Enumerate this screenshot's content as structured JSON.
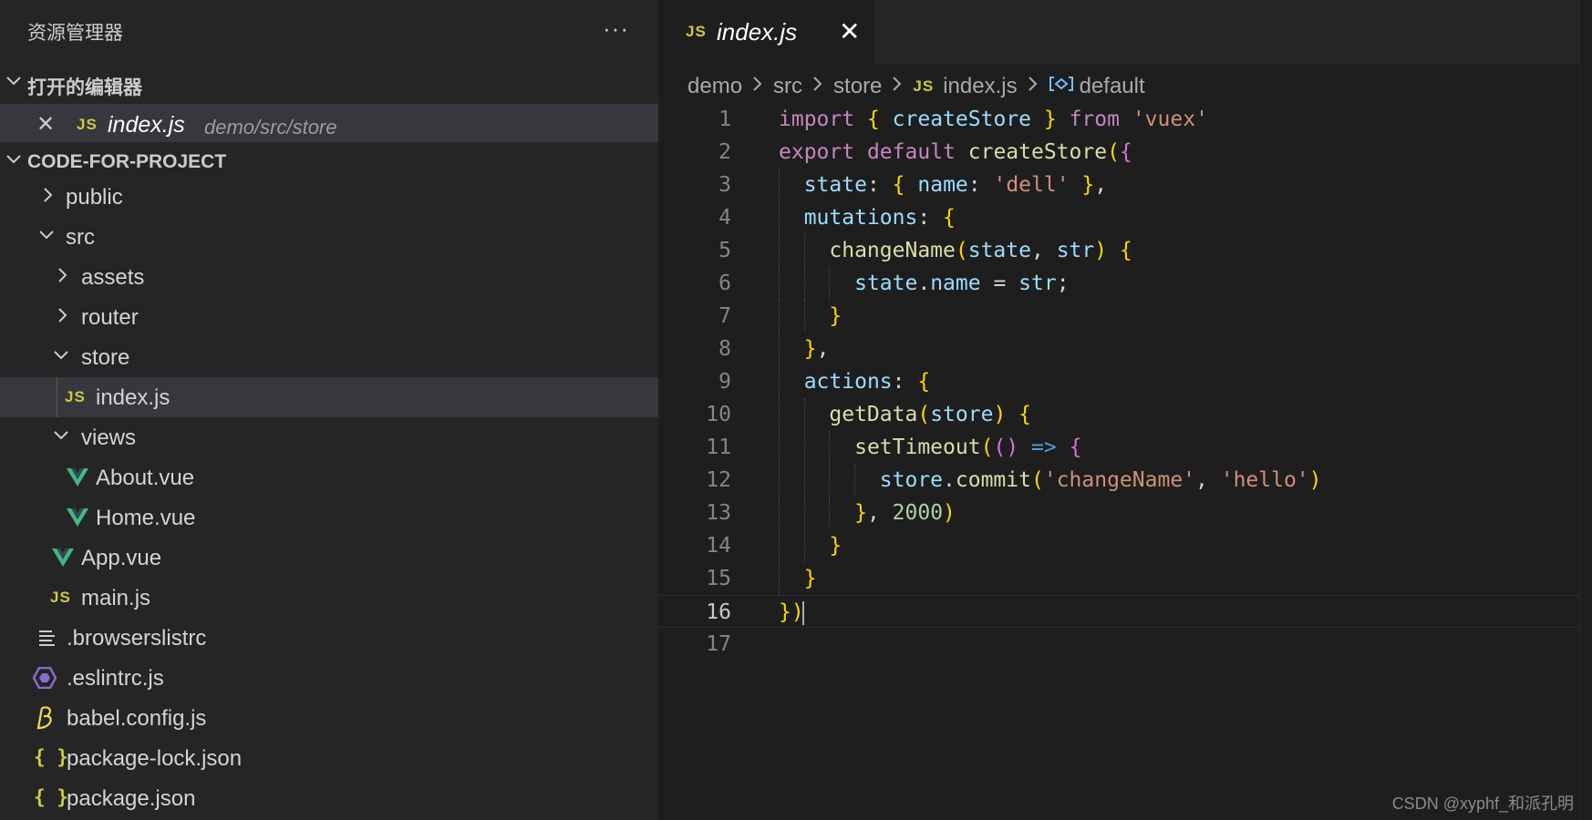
{
  "sidebar": {
    "title": "资源管理器",
    "more_label": "···",
    "open_editors": {
      "header": "打开的编辑器",
      "items": [
        {
          "close": "✕",
          "badge": "JS",
          "name": "index.js",
          "path": "demo/src/store"
        }
      ]
    },
    "project": {
      "header": "CODE-FOR-PROJECT",
      "tree": [
        {
          "label": "public",
          "icon": "chevron-right"
        },
        {
          "label": "src",
          "icon": "chevron-down"
        },
        {
          "label": "assets",
          "icon": "chevron-right"
        },
        {
          "label": "router",
          "icon": "chevron-right"
        },
        {
          "label": "store",
          "icon": "chevron-down"
        },
        {
          "label": "index.js",
          "icon": "js",
          "badge": "JS",
          "selected": true
        },
        {
          "label": "views",
          "icon": "chevron-down"
        },
        {
          "label": "About.vue",
          "icon": "vue"
        },
        {
          "label": "Home.vue",
          "icon": "vue"
        },
        {
          "label": "App.vue",
          "icon": "vue"
        },
        {
          "label": "main.js",
          "icon": "js",
          "badge": "JS"
        },
        {
          "label": ".browserslistrc",
          "icon": "lines"
        },
        {
          "label": ".eslintrc.js",
          "icon": "eslint"
        },
        {
          "label": "babel.config.js",
          "icon": "babel"
        },
        {
          "label": "package-lock.json",
          "icon": "json",
          "badge": "{ }"
        },
        {
          "label": "package.json",
          "icon": "json",
          "badge": "{ }"
        }
      ]
    }
  },
  "editor": {
    "tab": {
      "badge": "JS",
      "name": "index.js",
      "close": "✕"
    },
    "breadcrumb": [
      "demo",
      "src",
      "store",
      "index.js",
      "default"
    ],
    "breadcrumb_badge": "JS",
    "code_lines": [
      "import { createStore } from 'vuex'",
      "export default createStore({",
      "  state: { name: 'dell' },",
      "  mutations: {",
      "    changeName(state, str) {",
      "      state.name = str;",
      "    }",
      "  },",
      "  actions: {",
      "    getData(store) {",
      "      setTimeout(() => {",
      "        store.commit('changeName', 'hello')",
      "      }, 2000)",
      "    }",
      "  }",
      "})",
      ""
    ],
    "line_numbers": [
      "1",
      "2",
      "3",
      "4",
      "5",
      "6",
      "7",
      "8",
      "9",
      "10",
      "11",
      "12",
      "13",
      "14",
      "15",
      "16",
      "17"
    ],
    "active_line": "16"
  },
  "watermark": "CSDN @xyphf_和派孔明",
  "colors": {
    "sidebar_bg": "#252526",
    "editor_bg": "#1e1e1e",
    "js_badge": "#cbcb41",
    "vue_green": "#41b883",
    "keyword": "#c586c0",
    "string": "#ce9178"
  }
}
